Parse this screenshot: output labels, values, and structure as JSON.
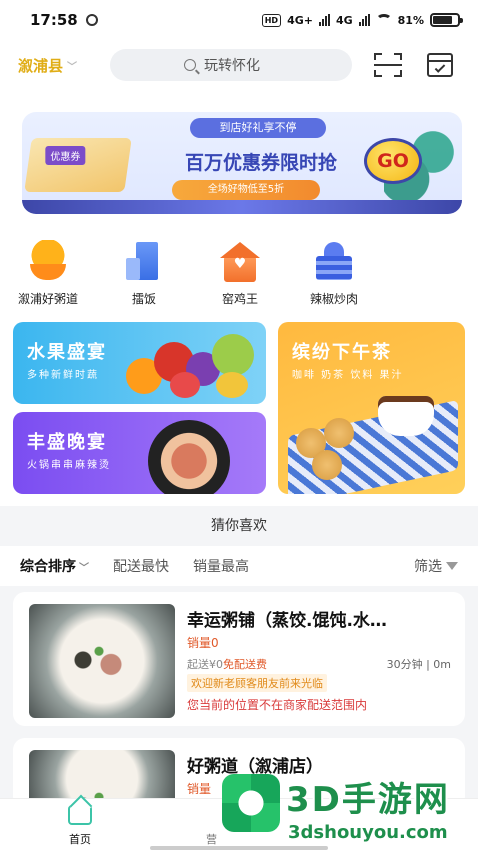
{
  "status_bar": {
    "time": "17:58",
    "hd": "HD",
    "net1": "4G+",
    "net2": "4G",
    "battery": "81%",
    "battery_level": 0.81
  },
  "header": {
    "location": "溆浦县",
    "search_placeholder": "玩转怀化",
    "scan_icon": "scan-icon",
    "calendar_icon": "calendar-check-icon"
  },
  "banner": {
    "ribbon": "到店好礼享不停",
    "coupon_tag": "优惠券",
    "title": "百万优惠券限时抢",
    "subtitle": "全场好物低至5折",
    "go": "GO"
  },
  "categories": [
    {
      "label": "溆浦好粥道",
      "icon": "porridge-bowl-icon"
    },
    {
      "label": "擂饭",
      "icon": "building-icon"
    },
    {
      "label": "窑鸡王",
      "icon": "house-heart-icon"
    },
    {
      "label": "辣椒炒肉",
      "icon": "temple-icon"
    }
  ],
  "tiles": {
    "fruit": {
      "title": "水果盛宴",
      "subtitle": "多种新鲜时蔬"
    },
    "dinner": {
      "title": "丰盛晚宴",
      "subtitle": "火锅串串麻辣烫"
    },
    "tea": {
      "title": "缤纷下午茶",
      "subtitle": "咖啡 奶茶 饮料 果汁"
    }
  },
  "guess": {
    "title": "猜你喜欢"
  },
  "sort": {
    "active": "综合排序",
    "options": [
      "配送最快",
      "销量最高"
    ],
    "filter": "筛选"
  },
  "shops": [
    {
      "name": "幸运粥铺（蒸饺.馄饨.水…",
      "sales": "销量0",
      "min_order": "起送¥0",
      "free_delivery": "免配送费",
      "time_distance": "30分钟 | 0m",
      "promo": "欢迎新老顾客朋友前来光临",
      "warning": "您当前的位置不在商家配送范围内"
    },
    {
      "name": "好粥道（溆浦店）",
      "sales": "销量"
    }
  ],
  "bottom_nav": {
    "home": "首页",
    "second": "营"
  },
  "watermark": {
    "big": "3D手游网",
    "small": "3dshouyou.com"
  },
  "colors": {
    "accent_green": "#3cc4a8",
    "location_yellow": "#e0ad16",
    "price_orange": "#e0592a",
    "warning_red": "#d93b3b"
  }
}
